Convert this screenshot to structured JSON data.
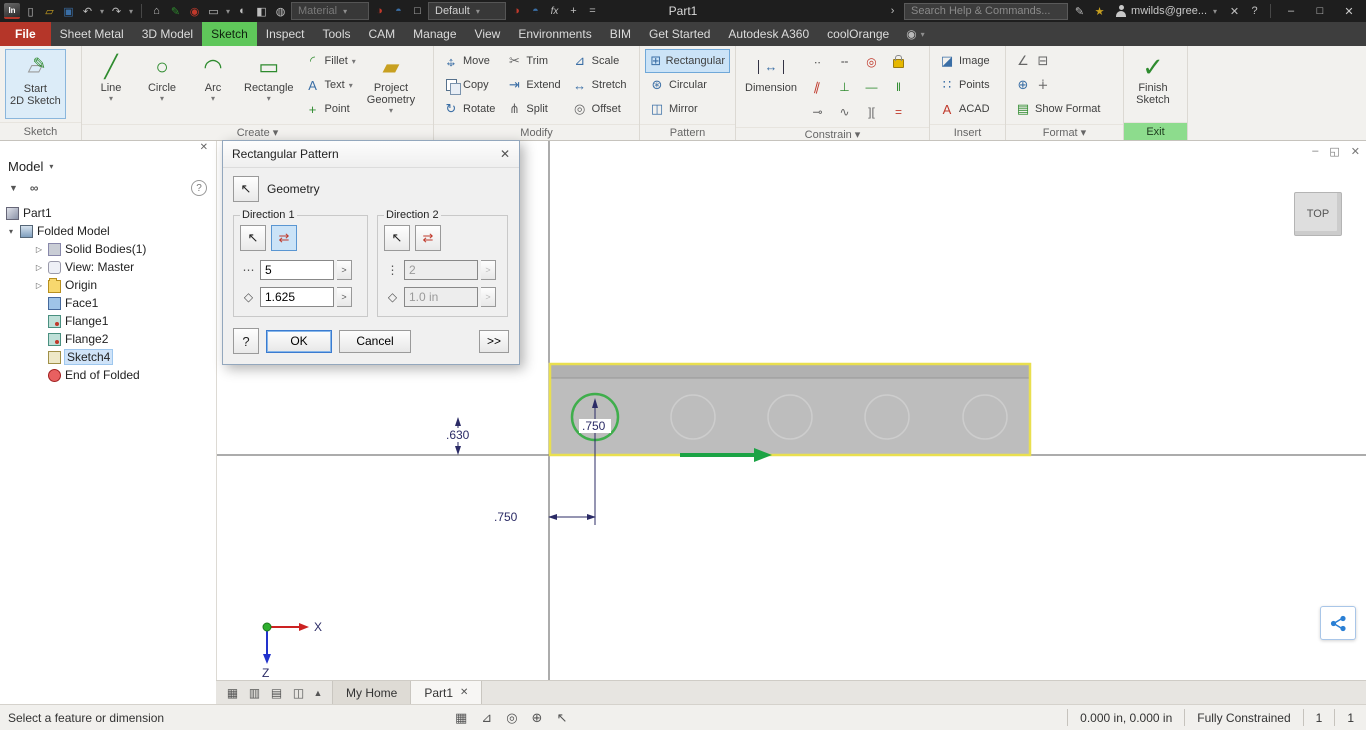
{
  "colors": {
    "titlebar_bg": "#1e1e1e",
    "menubar_bg": "#3e3e3e",
    "file_tab_red": "#b53629",
    "active_tab_green": "#5fc75a",
    "ribbon_bg": "#f2f1ee",
    "selected_tool_blue": "#cbe3f7",
    "highlight_yellow": "#e9df4f",
    "pattern_green": "#1ba345",
    "dimension_blue": "#2b2b66",
    "exit_label_green": "#8ddc8d"
  },
  "icons": {
    "app_logo": "In",
    "new_file": "▯",
    "open_folder": "▱",
    "save": "▣",
    "undo": "↶",
    "redo": "↷",
    "caret_down": "▾",
    "home": "⌂",
    "annotate": "✎",
    "camera": "◉",
    "display": "▭",
    "material_ball": "◐",
    "swatch": "◧",
    "globe": "◍",
    "orbit_red": "◑",
    "orbit_blue": "◓",
    "box": "□",
    "fx": "fx",
    "plus": "+",
    "equals": "=",
    "breadcrumb_arrow": "›",
    "pen": "✎",
    "star": "★",
    "xchange": "✕",
    "help": "?",
    "win_min": "–",
    "win_max": "□",
    "win_close": "✕",
    "menu_extra": "◉",
    "start_sketch": "✎",
    "plane": "▱",
    "line_tool": "╱",
    "circle_tool": "○",
    "arc_tool": "◠",
    "rect_tool": "▭",
    "fillet_tool": "◜",
    "text_tool": "A",
    "point_tool": "+",
    "project_tool": "▰",
    "move_h": "↔",
    "move_v": "↕",
    "rotate_tool": "↻",
    "trim_tool": "✂",
    "extend_tool": "⇥",
    "split_tool": "⋔",
    "scale_tool": "⊿",
    "stretch_tool": "↔",
    "offset_tool": "◎",
    "rect_pattern": "⊞",
    "circ_pattern": "⊛",
    "mirror_tool": "◫",
    "dimension_tool": "↔",
    "con_coincident": "∙∙",
    "con_collinear": "╌",
    "con_concentric": "◎",
    "con_parallel": "∥",
    "con_perpendicular": "⊥",
    "con_horizontal": "―",
    "con_vertical": "‖",
    "con_tangent": "⊸",
    "con_smooth": "∿",
    "con_symmetric": "][",
    "con_equal": "=",
    "image_tool": "◪",
    "points_tool": "∷",
    "acad": "A",
    "fmt_angle": "∠",
    "fmt_grid": "⊟",
    "fmt_target": "⊕",
    "fmt_plus": "∔",
    "show_format": "▤",
    "finish_check": "✓",
    "panel_close": "✕",
    "panel_help": "?",
    "funnel": "▼",
    "binoculars": "∞",
    "caret_expanded": "▾",
    "caret_collapsed": "▷",
    "tile_a": "▦",
    "tile_b": "▥",
    "tile_c": "▤",
    "tile_d": "◫",
    "tile_up": "▲",
    "status_grid": "▦",
    "status_tri": "⊿",
    "status_target": "⊕",
    "status_circ": "◎",
    "status_cursor": "↖",
    "pick_cursor": "↖",
    "flip_dir": "⇄",
    "dots_h": "⋯",
    "dots_v": "⋮",
    "diamond": "◇",
    "flyout": ">",
    "doc_min": "–",
    "doc_restore": "◱",
    "doc_close": "✕",
    "tab_close": "✕"
  },
  "titlebar": {
    "part_title": "Part1",
    "material_value": "Material",
    "style_value": "Default",
    "search_placeholder": "Search Help & Commands...",
    "user_name": "mwilds@gree..."
  },
  "menubar": {
    "tabs": [
      "File",
      "Sheet Metal",
      "3D Model",
      "Sketch",
      "Inspect",
      "Tools",
      "CAM",
      "Manage",
      "View",
      "Environments",
      "BIM",
      "Get Started",
      "Autodesk A360",
      "coolOrange"
    ]
  },
  "ribbon": {
    "sketch": {
      "label": "Sketch",
      "start_line1": "Start",
      "start_line2": "2D Sketch"
    },
    "create": {
      "label": "Create ▾",
      "line": "Line",
      "circle": "Circle",
      "arc": "Arc",
      "rectangle": "Rectangle",
      "fillet": "Fillet",
      "text": "Text",
      "point": "Point",
      "project_line1": "Project",
      "project_line2": "Geometry"
    },
    "modify": {
      "label": "Modify",
      "move": "Move",
      "copy": "Copy",
      "rotate": "Rotate",
      "trim": "Trim",
      "extend": "Extend",
      "split": "Split",
      "scale": "Scale",
      "stretch": "Stretch",
      "offset": "Offset"
    },
    "pattern": {
      "label": "Pattern",
      "rectangular": "Rectangular",
      "circular": "Circular",
      "mirror": "Mirror"
    },
    "constrain": {
      "label": "Constrain ▾",
      "dimension": "Dimension"
    },
    "insert": {
      "label": "Insert",
      "image": "Image",
      "points": "Points",
      "acad": "ACAD"
    },
    "format": {
      "label": "Format ▾",
      "show_format": "Show Format"
    },
    "exit": {
      "label": "Exit",
      "finish_line1": "Finish",
      "finish_line2": "Sketch"
    }
  },
  "browser": {
    "title": "Model",
    "items": [
      {
        "label": "Part1"
      },
      {
        "label": "Folded Model"
      },
      {
        "label": "Solid Bodies(1)"
      },
      {
        "label": "View: Master"
      },
      {
        "label": "Origin"
      },
      {
        "label": "Face1"
      },
      {
        "label": "Flange1"
      },
      {
        "label": "Flange2"
      },
      {
        "label": "Sketch4"
      },
      {
        "label": "End of Folded"
      }
    ]
  },
  "dialog": {
    "title": "Rectangular Pattern",
    "geometry_label": "Geometry",
    "direction1_label": "Direction 1",
    "direction2_label": "Direction 2",
    "d1_count": "5",
    "d1_spacing": "1.625",
    "d2_count": "2",
    "d2_spacing": "1.0 in",
    "ok_label": "OK",
    "cancel_label": "Cancel",
    "more_label": ">>"
  },
  "canvas": {
    "dim_height": ".630",
    "dim_offset_vertical": ".750",
    "dim_offset_horizontal": ".750",
    "viewcube_label": "TOP",
    "axis_x_label": "X",
    "axis_z_label": "Z"
  },
  "tabs_bar": {
    "my_home": "My Home",
    "part_tab": "Part1"
  },
  "statusbar": {
    "message": "Select a feature or dimension",
    "coordinates": "0.000 in, 0.000 in",
    "constraint_status": "Fully Constrained",
    "counter_a": "1",
    "counter_b": "1"
  }
}
